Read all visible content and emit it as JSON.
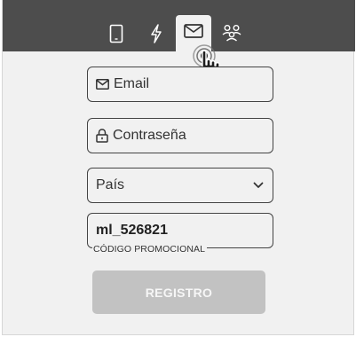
{
  "tabs": [
    {
      "id": "phone",
      "icon": "smartphone-icon"
    },
    {
      "id": "flash",
      "icon": "lightning-icon"
    },
    {
      "id": "email",
      "icon": "envelope-icon",
      "active": true
    },
    {
      "id": "group",
      "icon": "people-group-icon"
    }
  ],
  "form": {
    "email_placeholder": "Email",
    "password_placeholder": "Contraseña",
    "country_placeholder": "País",
    "promo_value": "ml_526821",
    "promo_label": "CÓDIGO PROMOCIONAL"
  },
  "register_label": "REGISTRO",
  "colors": {
    "header": "#4d4d4d",
    "panel": "#f1f1f1",
    "button_disabled": "#c2c2c2"
  }
}
